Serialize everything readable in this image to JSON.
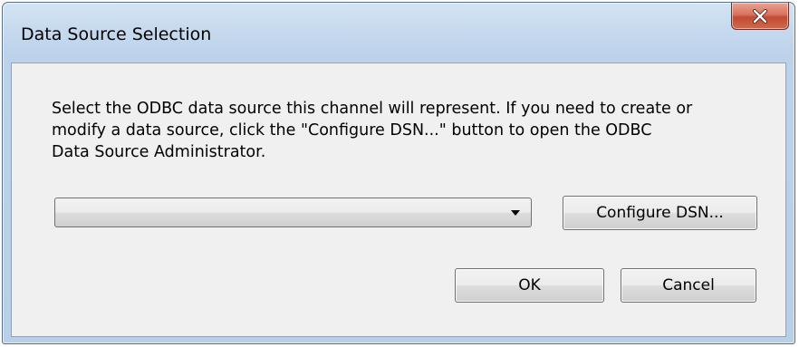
{
  "window": {
    "title": "Data Source Selection"
  },
  "titlebar": {
    "close_icon": "close-x-icon",
    "close_color": "#c34a33"
  },
  "dialog": {
    "description_lines": [
      "Select the ODBC data source this channel will represent. If you need to create or",
      "modify a data source, click the \"Configure DSN...\" button to open the ODBC",
      "Data Source Administrator."
    ],
    "data_source_select": {
      "value": "",
      "icon": "dropdown-arrow-icon"
    },
    "configure_label": "Configure DSN...",
    "ok_label": "OK",
    "cancel_label": "Cancel"
  }
}
